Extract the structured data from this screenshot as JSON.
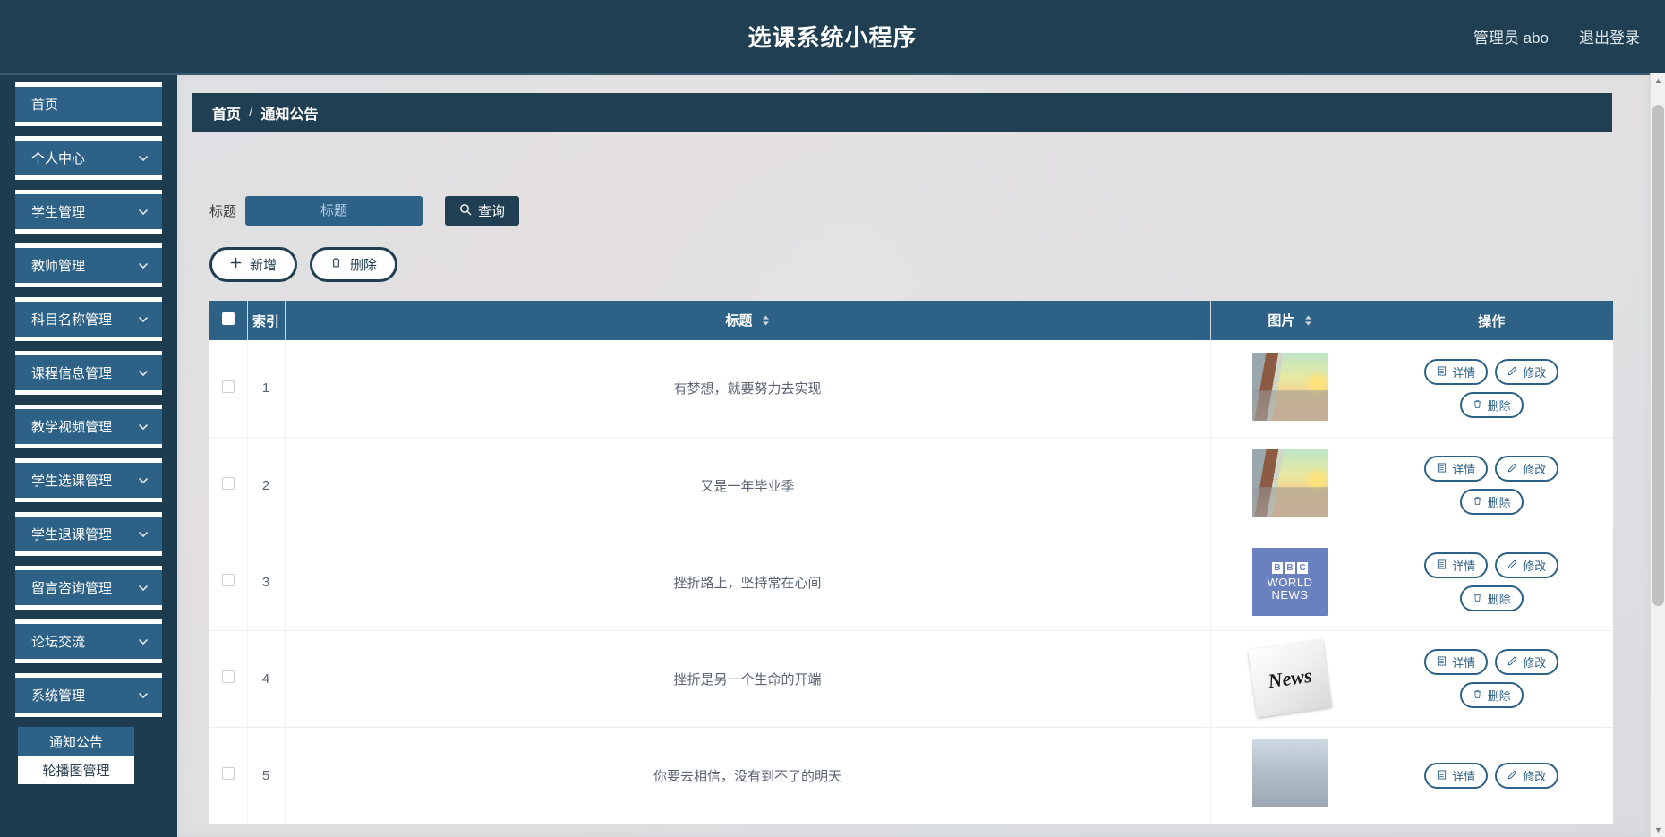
{
  "topbar": {
    "title": "选课系统小程序",
    "user": "管理员 abo",
    "logout": "退出登录"
  },
  "sidebar": {
    "items": [
      {
        "label": "首页",
        "expandable": false
      },
      {
        "label": "个人中心",
        "expandable": true
      },
      {
        "label": "学生管理",
        "expandable": true
      },
      {
        "label": "教师管理",
        "expandable": true
      },
      {
        "label": "科目名称管理",
        "expandable": true
      },
      {
        "label": "课程信息管理",
        "expandable": true
      },
      {
        "label": "教学视频管理",
        "expandable": true
      },
      {
        "label": "学生选课管理",
        "expandable": true
      },
      {
        "label": "学生退课管理",
        "expandable": true
      },
      {
        "label": "留言咨询管理",
        "expandable": true
      },
      {
        "label": "论坛交流",
        "expandable": true
      },
      {
        "label": "系统管理",
        "expandable": true
      }
    ],
    "submenu": [
      {
        "label": "通知公告",
        "active": true
      },
      {
        "label": "轮播图管理",
        "active": false
      }
    ]
  },
  "breadcrumb": {
    "home": "首页",
    "separator": "/",
    "current": "通知公告"
  },
  "search": {
    "label": "标题",
    "placeholder": "标题",
    "value": "",
    "button": "查询"
  },
  "toolbar": {
    "add_label": "新增",
    "delete_label": "删除"
  },
  "table": {
    "headers": {
      "index": "索引",
      "title": "标题",
      "image": "图片",
      "operation": "操作"
    },
    "ops": {
      "detail": "详情",
      "edit": "修改",
      "delete": "删除"
    },
    "rows": [
      {
        "index": "1",
        "title": "有梦想，就要努力去实现",
        "image_kind": "campus"
      },
      {
        "index": "2",
        "title": "又是一年毕业季",
        "image_kind": "campus"
      },
      {
        "index": "3",
        "title": "挫折路上，坚持常在心间",
        "image_kind": "bbc"
      },
      {
        "index": "4",
        "title": "挫折是另一个生命的开端",
        "image_kind": "news"
      },
      {
        "index": "5",
        "title": "你要去相信，没有到不了的明天",
        "image_kind": "building"
      }
    ],
    "image_labels": {
      "bbc_b1": "B",
      "bbc_b2": "B",
      "bbc_c": "C",
      "bbc_world": "WORLD",
      "bbc_news": "NEWS",
      "news_word": "News"
    }
  },
  "colors": {
    "header_bg": "#213f52",
    "sidebar_bg": "#1e3c50",
    "accent": "#2e6186",
    "content_bg": "#e8e8e8"
  }
}
